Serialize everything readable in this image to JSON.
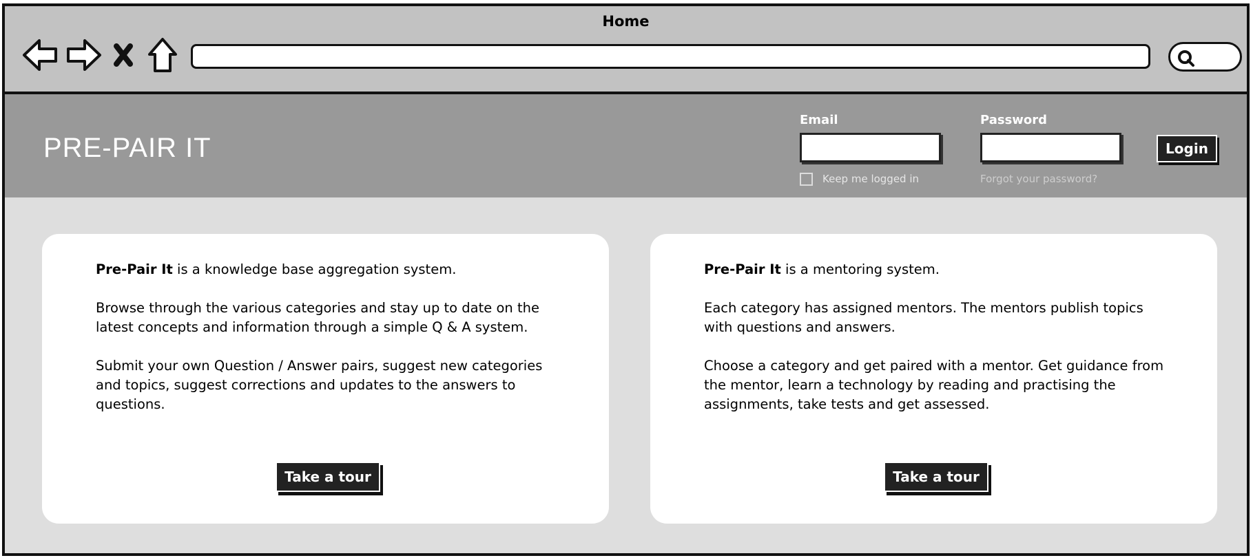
{
  "window": {
    "title": "Home"
  },
  "browser": {
    "url": "",
    "nav_icons": [
      "back-arrow-icon",
      "forward-arrow-icon",
      "close-x-icon",
      "home-icon"
    ],
    "search_icon": "search-icon"
  },
  "header": {
    "brand": "PRE-PAIR IT",
    "email_label": "Email",
    "email_value": "",
    "password_label": "Password",
    "password_value": "",
    "keep_logged_in": "Keep me logged in",
    "keep_logged_in_checked": false,
    "forgot_password": "Forgot your password?",
    "login_button": "Login"
  },
  "cards": [
    {
      "bold_name": "Pre-Pair It",
      "intro_rest": " is a knowledge base aggregation system.",
      "paragraphs": [
        "Browse through the various categories and stay up to date on the latest concepts and information through a simple Q & A system.",
        "Submit your own Question / Answer pairs, suggest new categories and topics, suggest corrections and updates to the answers to questions."
      ],
      "button": "Take a tour"
    },
    {
      "bold_name": "Pre-Pair It",
      "intro_rest": " is a mentoring system.",
      "paragraphs": [
        "Each category has assigned mentors. The mentors publish topics with questions and answers.",
        "Choose a category and get paired with a mentor. Get guidance from the mentor, learn a technology by reading and practising the assignments, take tests and get assessed."
      ],
      "button": "Take a tour"
    }
  ],
  "colors": {
    "chrome_bg": "#c2c2c2",
    "header_bg": "#999999",
    "content_bg": "#dedede",
    "button_bg": "#222222"
  }
}
